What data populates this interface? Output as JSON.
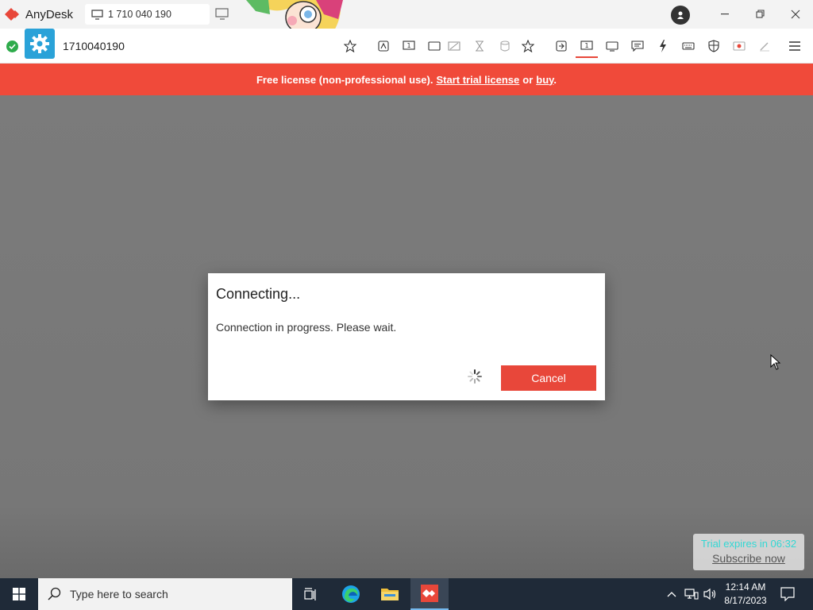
{
  "titlebar": {
    "app_name": "AnyDesk",
    "address_tab": "1 710 040 190"
  },
  "toolbar": {
    "remote_id": "1710040190"
  },
  "banner": {
    "prefix": "Free license (non-professional use).",
    "trial_link": "Start trial license",
    "or": "or",
    "buy_link": "buy",
    "suffix": "."
  },
  "dialog": {
    "title": "Connecting...",
    "message": "Connection in progress. Please wait.",
    "cancel_label": "Cancel"
  },
  "trial_popup": {
    "text": "Trial expires in 06:32",
    "link": "Subscribe now"
  },
  "taskbar": {
    "search_placeholder": "Type here to search",
    "time": "12:14 AM",
    "date": "8/17/2023"
  },
  "colors": {
    "accent": "#e8473a",
    "banner": "#f04a3a",
    "connected": "#2eab4b",
    "settings_tile": "#2aa2d8",
    "trial_text": "#31d8d4"
  }
}
